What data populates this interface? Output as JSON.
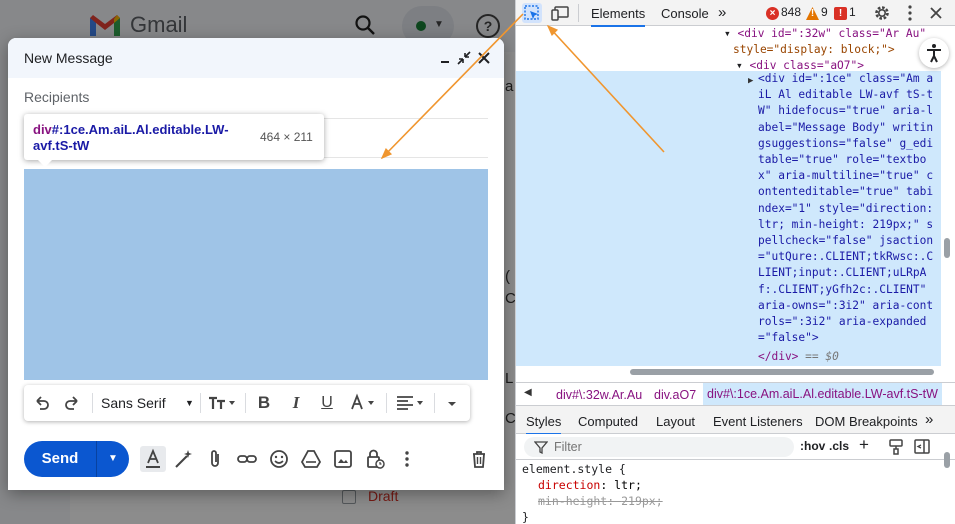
{
  "gmail": {
    "app_name": "Gmail",
    "edge_snippets": [
      "a",
      "(",
      "C",
      "L",
      "C"
    ],
    "draft_label": "Draft"
  },
  "compose": {
    "title": "New Message",
    "recipients_placeholder": "Recipients",
    "inspect_tooltip": {
      "tag": "div",
      "selector": "#:1ce.Am.aiL.Al.editable.LW-avf.tS-tW",
      "dimensions": "464 × 211"
    },
    "toolbar": {
      "font_family": "Sans Serif"
    },
    "send_label": "Send"
  },
  "devtools": {
    "tabs": [
      "Elements",
      "Console"
    ],
    "more_tabs": "»",
    "errors_count": "848",
    "warnings_count": "9",
    "issues_count": "1",
    "dom_lines": {
      "line1": "<div id=\":32w\" class=\"Ar Au\"",
      "line2": "style=\"display: block;\">",
      "line3": "<div class=\"aO7\">",
      "selected_code": "<div id=\":1ce\" class=\"Am aiL Al editable LW-avf tS-tW\" hidefocus=\"true\" aria-label=\"Message Body\" writingsuggestions=\"false\" g_editable=\"true\" role=\"textbox\" aria-multiline=\"true\" contenteditable=\"true\" tabindex=\"1\" style=\"direction: ltr; min-height: 219px;\" spellcheck=\"false\" jsaction=\"utQure:.CLIENT;tkRwsc:.CLIENT;input:.CLIENT;uLRpAf:.CLIENT;yGfh2c:.CLIENT\" aria-owns=\":3i2\" aria-controls=\":3i2\" aria-expanded=\"false\">",
      "closing": "</div>",
      "eq_marker": "== $0"
    },
    "breadcrumb": [
      "div#\\:32w.Ar.Au",
      "div.aO7",
      "div#\\:1ce.Am.aiL.Al.editable.LW-avf.tS-tW"
    ],
    "sub_tabs": [
      "Styles",
      "Computed",
      "Layout",
      "Event Listeners",
      "DOM Breakpoints"
    ],
    "filter_placeholder": "Filter",
    "filter_buttons": [
      ":hov",
      ".cls",
      "+"
    ],
    "styles": {
      "selector": "element.style {",
      "rules": [
        {
          "prop": "direction",
          "value": "ltr;"
        },
        {
          "prop": "min-height",
          "value": "219px;"
        }
      ],
      "close": "}"
    }
  },
  "colors": {
    "gmail_red": "#ea4335",
    "send_blue": "#0b57d0",
    "inspect_highlight": "#9fc4e7",
    "devtools_selection": "#cfe8fc",
    "arrow_orange": "#f0962f"
  }
}
